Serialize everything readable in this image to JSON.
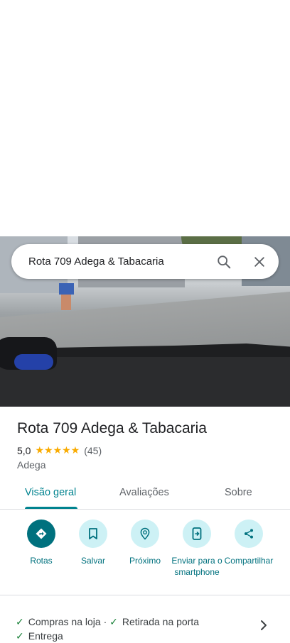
{
  "search": {
    "query": "Rota 709 Adega & Tabacaria"
  },
  "place": {
    "name": "Rota 709 Adega & Tabacaria",
    "rating": "5,0",
    "stars": "★★★★★",
    "reviews": "(45)",
    "category": "Adega"
  },
  "tabs": [
    {
      "label": "Visão geral",
      "active": true
    },
    {
      "label": "Avaliações"
    },
    {
      "label": "Sobre"
    }
  ],
  "actions": [
    {
      "label": "Rotas",
      "icon": "directions-icon"
    },
    {
      "label": "Salvar",
      "icon": "bookmark-icon"
    },
    {
      "label": "Próximo",
      "icon": "nearby-icon"
    },
    {
      "label": "Enviar para o smartphone",
      "icon": "send-to-phone-icon"
    },
    {
      "label": "Compartilhar",
      "icon": "share-icon"
    }
  ],
  "services": {
    "items": [
      "Compras na loja",
      "Retirada na porta",
      "Entrega"
    ],
    "separator": "·"
  },
  "colors": {
    "accent": "#00717e",
    "star": "#f9ab00",
    "check": "#188038"
  }
}
